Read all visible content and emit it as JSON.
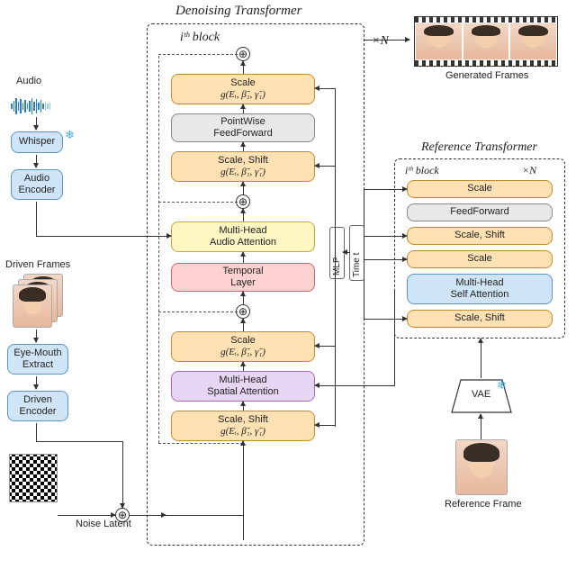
{
  "titles": {
    "denoising": "Denoising Transformer",
    "reference": "Reference Transformer",
    "generated": "Generated Frames",
    "ref_frame": "Reference Frame",
    "audio": "Audio",
    "driven": "Driven Frames",
    "noise": "Noise Latent"
  },
  "left": {
    "whisper": "Whisper",
    "audio_encoder": "Audio\nEncoder",
    "eye_mouth": "Eye-Mouth\nExtract",
    "driven_encoder": "Driven\nEncoder"
  },
  "denoise": {
    "ith": "iᵗʰ block",
    "xn": "×N",
    "scale_top": "Scale",
    "g1": "g(Eᵢ, β̃₁, γ̃₁)",
    "pw": "PointWise\nFeedForward",
    "scaleshift_a": "Scale, Shift",
    "g2": "g(Eᵢ, β̃₁, γ̃₁)",
    "audio_attn": "Multi-Head\nAudio Attention",
    "temporal": "Temporal\nLayer",
    "scale_mid": "Scale",
    "g3": "g(Eᵢ, β̃₁, γ̃₁)",
    "spatial_attn": "Multi-Head\nSpatial Attention",
    "scaleshift_b": "Scale, Shift",
    "g4": "g(Eᵢ, β̃₁, γ̃₁)"
  },
  "side": {
    "mlp": "MLP",
    "time": "Time t"
  },
  "ref": {
    "ith": "iᵗʰ block",
    "xn": "×N",
    "scale1": "Scale",
    "ff": "FeedForward",
    "scaleshift1": "Scale, Shift",
    "scale2": "Scale",
    "self_attn": "Multi-Head\nSelf Attention",
    "scaleshift2": "Scale, Shift",
    "vae": "VAE"
  },
  "chart_data": {
    "type": "diagram",
    "description": "Architecture diagram with two transformers (Denoising and Reference). Inputs: audio via Whisper+Audio Encoder, driven frames via Eye-Mouth Extract+Driven Encoder, noise latent, reference frame via VAE. Denoising block (repeated N times) stacks Scale/Shift (g(E_i, β̃1, γ̃1)) modulation around Multi-Head Spatial Attention, Temporal Layer, Multi-Head Audio Attention, and PointWise FeedForward with residual additions. MLP conditioned on Time t feeds modulation. Reference Transformer block (×N) has Scale/Shift around Multi-Head Self Attention and FeedForward. Reference Transformer output feeds Multi-Head Spatial Attention of Denoising Transformer. Output: Generated Frames."
  }
}
